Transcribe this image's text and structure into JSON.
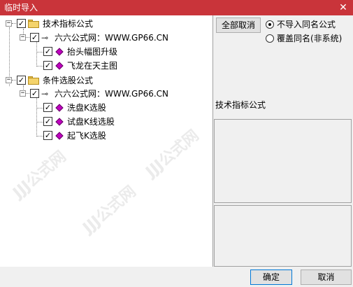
{
  "window": {
    "title": "临时导入",
    "close_glyph": "✕"
  },
  "tree": {
    "groups": [
      {
        "label": "技术指标公式",
        "checked": true,
        "expanded": true,
        "source": {
          "label": "六六公式网：WWW.GP66.CN",
          "checked": true,
          "items": [
            {
              "label": "抬头幅图升级",
              "checked": true
            },
            {
              "label": "飞龙在天主图",
              "checked": true
            }
          ]
        }
      },
      {
        "label": "条件选股公式",
        "checked": true,
        "expanded": true,
        "source": {
          "label": "六六公式网：WWW.GP66.CN",
          "checked": true,
          "items": [
            {
              "label": "洗盘K选股",
              "checked": true
            },
            {
              "label": "试盘K线选股",
              "checked": true
            },
            {
              "label": "起飞K选股",
              "checked": true
            }
          ]
        }
      }
    ],
    "check_glyph": "✓",
    "collapse_glyph": "−",
    "key_glyph": "⊸"
  },
  "options": {
    "cancel_all_label": "全部取消",
    "radio_no_import": "不导入同名公式",
    "radio_overwrite": "覆盖同名(非系统)",
    "selected": "no_import"
  },
  "detail": {
    "title": "技术指标公式"
  },
  "footer": {
    "ok_label": "确定",
    "cancel_label": "取消"
  },
  "watermark": {
    "text": "JJJ公式网"
  }
}
